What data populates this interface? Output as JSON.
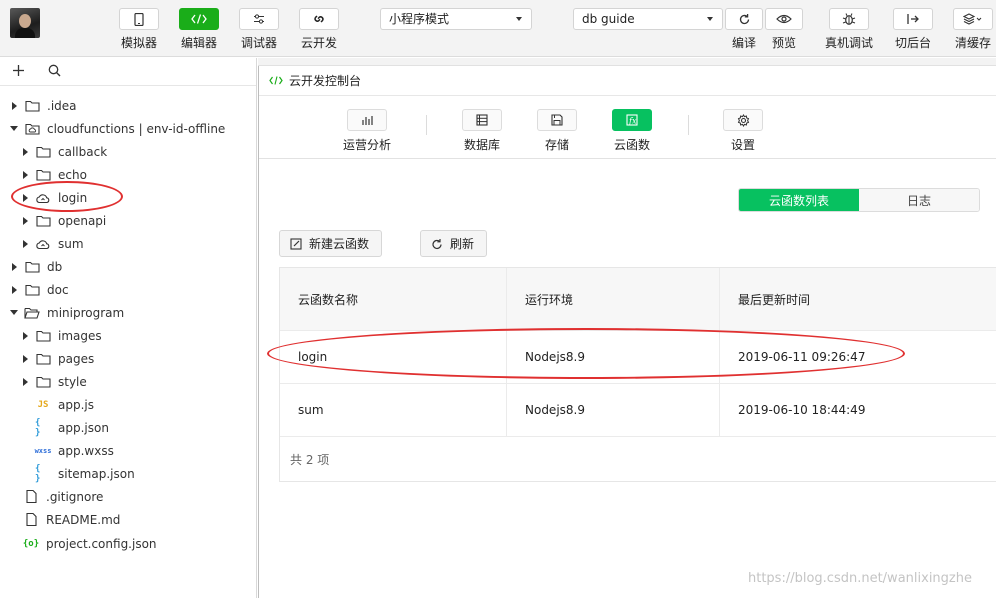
{
  "toolbar": {
    "left_tools": [
      {
        "label": "模拟器",
        "icon": "phone-icon"
      },
      {
        "label": "编辑器",
        "icon": "code-icon"
      },
      {
        "label": "调试器",
        "icon": "debug-sliders-icon"
      },
      {
        "label": "云开发",
        "icon": "cloud-link-icon"
      }
    ],
    "mode_select": "小程序模式",
    "project_select": "db guide",
    "right_tools": [
      {
        "label": "编译",
        "icon": "refresh-icon"
      },
      {
        "label": "预览",
        "icon": "eye-icon"
      },
      {
        "label": "真机调试",
        "icon": "bug-icon"
      },
      {
        "label": "切后台",
        "icon": "exit-icon"
      },
      {
        "label": "清缓存",
        "icon": "layers-icon"
      }
    ]
  },
  "sidebar": {
    "tree": [
      {
        "label": ".idea",
        "type": "folder",
        "depth": 0,
        "expanded": false
      },
      {
        "label": "cloudfunctions | env-id-offline",
        "type": "cloud-folder",
        "depth": 0,
        "expanded": true
      },
      {
        "label": "callback",
        "type": "folder",
        "depth": 1,
        "expanded": false
      },
      {
        "label": "echo",
        "type": "folder",
        "depth": 1,
        "expanded": false
      },
      {
        "label": "login",
        "type": "cloud",
        "depth": 1,
        "expanded": false
      },
      {
        "label": "openapi",
        "type": "folder",
        "depth": 1,
        "expanded": false
      },
      {
        "label": "sum",
        "type": "cloud",
        "depth": 1,
        "expanded": false
      },
      {
        "label": "db",
        "type": "folder",
        "depth": 0,
        "expanded": false
      },
      {
        "label": "doc",
        "type": "folder",
        "depth": 0,
        "expanded": false
      },
      {
        "label": "miniprogram",
        "type": "open-folder",
        "depth": 0,
        "expanded": true
      },
      {
        "label": "images",
        "type": "folder",
        "depth": 1,
        "expanded": false
      },
      {
        "label": "pages",
        "type": "folder",
        "depth": 1,
        "expanded": false
      },
      {
        "label": "style",
        "type": "folder",
        "depth": 1,
        "expanded": false
      },
      {
        "label": "app.js",
        "type": "js",
        "depth": 1
      },
      {
        "label": "app.json",
        "type": "json",
        "depth": 1
      },
      {
        "label": "app.wxss",
        "type": "wxss",
        "depth": 1
      },
      {
        "label": "sitemap.json",
        "type": "json",
        "depth": 1
      },
      {
        "label": ".gitignore",
        "type": "file",
        "depth": 0
      },
      {
        "label": "README.md",
        "type": "file",
        "depth": 0
      },
      {
        "label": "project.config.json",
        "type": "config",
        "depth": 0
      }
    ]
  },
  "console": {
    "title": "云开发控制台",
    "tabs": [
      {
        "label": "运营分析",
        "icon": "bar-chart-icon"
      },
      {
        "label": "数据库",
        "icon": "database-icon"
      },
      {
        "label": "存储",
        "icon": "storage-icon"
      },
      {
        "label": "云函数",
        "icon": "function-icon",
        "active": true
      },
      {
        "label": "设置",
        "icon": "gear-icon"
      }
    ],
    "segments": [
      "云函数列表",
      "日志"
    ],
    "buttons": {
      "new_function": "新建云函数",
      "refresh": "刷新"
    },
    "table": {
      "headers": [
        "云函数名称",
        "运行环境",
        "最后更新时间"
      ],
      "rows": [
        [
          "login",
          "Nodejs8.9",
          "2019-06-11 09:26:47"
        ],
        [
          "sum",
          "Nodejs8.9",
          "2019-06-10 18:44:49"
        ]
      ],
      "footer": "共 2 项"
    }
  },
  "watermark": "https://blog.csdn.net/wanlixingzhe",
  "colors": {
    "accent": "#07c160",
    "toolbar_green": "#1aad19",
    "annotation": "#e03030"
  }
}
